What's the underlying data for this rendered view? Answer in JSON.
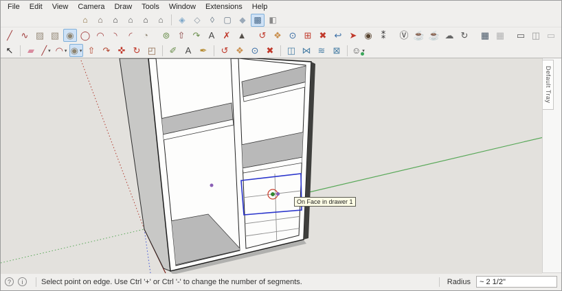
{
  "menu": {
    "items": [
      "File",
      "Edit",
      "View",
      "Camera",
      "Draw",
      "Tools",
      "Window",
      "Extensions",
      "Help"
    ]
  },
  "toolbars": {
    "views_row": {
      "groups": [
        {
          "name": "standard-views",
          "icons": [
            {
              "name": "view-iso",
              "glyph": "⌂",
              "color": "#8a6d3b"
            },
            {
              "name": "view-top",
              "glyph": "⌂",
              "color": "#6f6257"
            },
            {
              "name": "view-front",
              "glyph": "⌂",
              "color": "#3a3a3a"
            },
            {
              "name": "view-right",
              "glyph": "⌂",
              "color": "#5c5c5c"
            },
            {
              "name": "view-back",
              "glyph": "⌂",
              "color": "#3a3a3a"
            },
            {
              "name": "view-left",
              "glyph": "⌂",
              "color": "#5c5c5c"
            }
          ]
        },
        {
          "name": "face-styles",
          "icons": [
            {
              "name": "style-xray",
              "glyph": "◈",
              "color": "#7da7c9"
            },
            {
              "name": "style-back-edges",
              "glyph": "◇",
              "color": "#8a97a3"
            },
            {
              "name": "style-wireframe",
              "glyph": "◊",
              "color": "#6a7a88"
            },
            {
              "name": "style-hidden-line",
              "glyph": "▢",
              "color": "#6a7a88"
            },
            {
              "name": "style-shaded",
              "glyph": "◆",
              "color": "#9aa9b8"
            },
            {
              "name": "style-shaded-textures",
              "glyph": "▩",
              "color": "#4a6a8a",
              "selected": true
            },
            {
              "name": "style-monochrome",
              "glyph": "◧",
              "color": "#8a8a8a"
            }
          ]
        }
      ]
    },
    "main_row": {
      "groups": [
        {
          "name": "drawing-tools",
          "icons": [
            {
              "name": "line-tool",
              "glyph": "╱",
              "color": "#a03c3c"
            },
            {
              "name": "freehand-tool",
              "glyph": "∿",
              "color": "#a03c3c"
            },
            {
              "name": "rectangle-tool",
              "glyph": "▨",
              "color": "#9a8f7f"
            },
            {
              "name": "rotated-rectangle-tool",
              "glyph": "▧",
              "color": "#9a8f7f"
            },
            {
              "name": "circle-tool",
              "glyph": "◉",
              "color": "#8f8570",
              "selected": true
            },
            {
              "name": "polygon-tool",
              "glyph": "◯",
              "color": "#a03c3c"
            },
            {
              "name": "arc-tool",
              "glyph": "◠",
              "color": "#a03c3c"
            },
            {
              "name": "two-point-arc-tool",
              "glyph": "◝",
              "color": "#a03c3c"
            },
            {
              "name": "three-point-arc-tool",
              "glyph": "◜",
              "color": "#a03c3c"
            },
            {
              "name": "pie-tool",
              "glyph": "◔",
              "color": "#9a8f7f"
            }
          ]
        },
        {
          "name": "edit-tools",
          "icons": [
            {
              "name": "offset-tool",
              "glyph": "⊚",
              "color": "#6b8f4e"
            },
            {
              "name": "push-pull-tool",
              "glyph": "⇧",
              "color": "#8a4444"
            },
            {
              "name": "follow-me-tool",
              "glyph": "↷",
              "color": "#6b8f4e"
            },
            {
              "name": "text-tool",
              "glyph": "A",
              "color": "#444444"
            },
            {
              "name": "axes-tool",
              "glyph": "✗",
              "color": "#c0392b"
            },
            {
              "name": "3d-text-tool",
              "glyph": "▲",
              "color": "#55504a"
            }
          ]
        },
        {
          "name": "camera-tools",
          "icons": [
            {
              "name": "orbit-tool",
              "glyph": "↺",
              "color": "#c0392b"
            },
            {
              "name": "pan-tool",
              "glyph": "❖",
              "color": "#c98f4e"
            },
            {
              "name": "zoom-tool",
              "glyph": "⊙",
              "color": "#3a6ea5"
            },
            {
              "name": "zoom-window-tool",
              "glyph": "⊞",
              "color": "#c0392b"
            },
            {
              "name": "zoom-extents-tool",
              "glyph": "✖",
              "color": "#c0392b"
            },
            {
              "name": "zoom-previous-tool",
              "glyph": "↩",
              "color": "#3a6ea5"
            },
            {
              "name": "position-camera-tool",
              "glyph": "➤",
              "color": "#c0392b"
            },
            {
              "name": "look-around-tool",
              "glyph": "◉",
              "color": "#5a4632"
            },
            {
              "name": "walk-tool",
              "glyph": "⁑",
              "color": "#333333"
            }
          ]
        },
        {
          "name": "vray-render",
          "icons": [
            {
              "name": "vray-logo",
              "glyph": "Ⓥ",
              "color": "#333333"
            },
            {
              "name": "render-teapot",
              "glyph": "☕",
              "color": "#444444"
            },
            {
              "name": "render-interactive",
              "glyph": "☕",
              "color": "#777777"
            },
            {
              "name": "chaos-cloud",
              "glyph": "☁",
              "color": "#666666"
            },
            {
              "name": "cosmos-sync",
              "glyph": "↻",
              "color": "#555555"
            }
          ]
        },
        {
          "name": "vray-buffer",
          "icons": [
            {
              "name": "frame-buffer",
              "glyph": "▦",
              "color": "#4a5a6a"
            },
            {
              "name": "frame-buffer-secondary",
              "glyph": "▦",
              "color": "#b5b5b5"
            }
          ]
        },
        {
          "name": "vray-windows",
          "icons": [
            {
              "name": "asset-editor",
              "glyph": "▭",
              "color": "#555555"
            },
            {
              "name": "vfb-settings",
              "glyph": "◫",
              "color": "#999999"
            },
            {
              "name": "cloud-batch",
              "glyph": "▭",
              "color": "#b5b5b5"
            },
            {
              "name": "lock-viewport",
              "glyph": "▣",
              "color": "#b5b5b5"
            }
          ]
        }
      ]
    },
    "tools_row": {
      "groups": [
        {
          "name": "select-group",
          "icons": [
            {
              "name": "select-tool",
              "glyph": "↖",
              "color": "#222222"
            }
          ]
        },
        {
          "name": "modify-group",
          "icons": [
            {
              "name": "eraser-tool",
              "glyph": "▰",
              "color": "#d98b9f"
            },
            {
              "name": "line-tool-flyout",
              "glyph": "╱",
              "color": "#a03c3c",
              "dropdown": true
            },
            {
              "name": "arc-tool-flyout",
              "glyph": "◠",
              "color": "#a03c3c",
              "dropdown": true
            },
            {
              "name": "circle-tool-flyout",
              "glyph": "◉",
              "color": "#8f8570",
              "selected": true,
              "dropdown": true
            },
            {
              "name": "push-pull-tool",
              "glyph": "⇧",
              "color": "#b2452f"
            },
            {
              "name": "follow-me-tool",
              "glyph": "↷",
              "color": "#b2452f"
            },
            {
              "name": "move-tool",
              "glyph": "✜",
              "color": "#c0392b"
            },
            {
              "name": "rotate-tool",
              "glyph": "↻",
              "color": "#c0392b"
            },
            {
              "name": "scale-tool",
              "glyph": "◰",
              "color": "#8f6b4e"
            }
          ]
        },
        {
          "name": "annotate-group",
          "icons": [
            {
              "name": "tape-measure-tool",
              "glyph": "✐",
              "color": "#6b8f4e"
            },
            {
              "name": "text-tool",
              "glyph": "A",
              "color": "#444444"
            },
            {
              "name": "paint-bucket-tool",
              "glyph": "✒",
              "color": "#b58a2f"
            }
          ]
        },
        {
          "name": "camera-group",
          "icons": [
            {
              "name": "orbit-tool",
              "glyph": "↺",
              "color": "#c0392b"
            },
            {
              "name": "pan-tool",
              "glyph": "❖",
              "color": "#c98f4e"
            },
            {
              "name": "zoom-tool",
              "glyph": "⊙",
              "color": "#3a6ea5"
            },
            {
              "name": "zoom-extents-tool",
              "glyph": "✖",
              "color": "#c0392b"
            }
          ]
        },
        {
          "name": "section-group",
          "icons": [
            {
              "name": "section-plane-tool",
              "glyph": "◫",
              "color": "#4a7fa5"
            },
            {
              "name": "section-display-toggle",
              "glyph": "⋈",
              "color": "#4a7fa5"
            },
            {
              "name": "section-cut-toggle",
              "glyph": "≋",
              "color": "#4a7fa5"
            },
            {
              "name": "section-fill-toggle",
              "glyph": "⊠",
              "color": "#4a7fa5"
            }
          ]
        },
        {
          "name": "account-group",
          "icons": [
            {
              "name": "account",
              "glyph": "☺",
              "color": "#555555",
              "dropdown": true,
              "badge": "#3aa65a"
            }
          ]
        }
      ]
    }
  },
  "canvas": {
    "tooltip": "On Face in drawer 1",
    "colors": {
      "background": "#e3e1dd",
      "axis_red": "#b03a2e",
      "axis_green": "#58a858",
      "axis_blue": "#3b4fd8",
      "selection": "#2a35cc",
      "preview_red": "#cc4433",
      "point_green": "#2e8b2e",
      "point_purple": "#8a5fb5",
      "face_white": "#fdfdfc",
      "shelf_gray": "#bcbcbc",
      "side_gray": "#c8c8c6",
      "edge_black": "#1c1c1c"
    }
  },
  "tray": {
    "tab_label": "Default Tray"
  },
  "status_bar": {
    "icons": [
      {
        "name": "help-icon",
        "glyph": "?"
      },
      {
        "name": "context-info-icon",
        "glyph": "i"
      }
    ],
    "message": "Select point on edge. Use Ctrl '+' or Ctrl '-' to change the number of segments.",
    "measurement_label": "Radius",
    "measurement_value": "~ 2 1/2\""
  }
}
